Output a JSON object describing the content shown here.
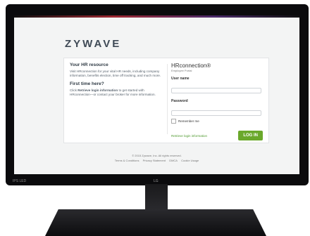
{
  "brand": {
    "logo_text": "ZYWAVE"
  },
  "left": {
    "resource_heading": "Your HR resource",
    "resource_body": "Visit HRconnection for your vital HR needs, including company information, benefits election, time off tracking, and much more.",
    "first_time_heading": "First time here?",
    "first_time_body_pre": "Click",
    "first_time_link": "Retrieve login information",
    "first_time_body_post": "to get started with HRconnection—or contact your broker for more information."
  },
  "right": {
    "product_name": "HRconnection®",
    "product_sub": "Employee Portal",
    "username_label": "User name",
    "username_value": "",
    "password_label": "Password",
    "password_value": "",
    "remember_label": "Remember me",
    "retrieve_link": "Retrieve login information",
    "login_button": "LOG IN"
  },
  "footer": {
    "copyright": "© 2015 Zywave, Inc. All rights reserved.",
    "links": [
      "Terms & Conditions",
      "Privacy Statement",
      "DMCA",
      "Cookie Usage"
    ]
  },
  "bezel": {
    "model_label": "IPS LED",
    "brand_mark": "LG"
  },
  "colors": {
    "accent_green": "#6aa82b",
    "link_green": "#4f9a2f",
    "bezel": "#0b0b0d"
  }
}
